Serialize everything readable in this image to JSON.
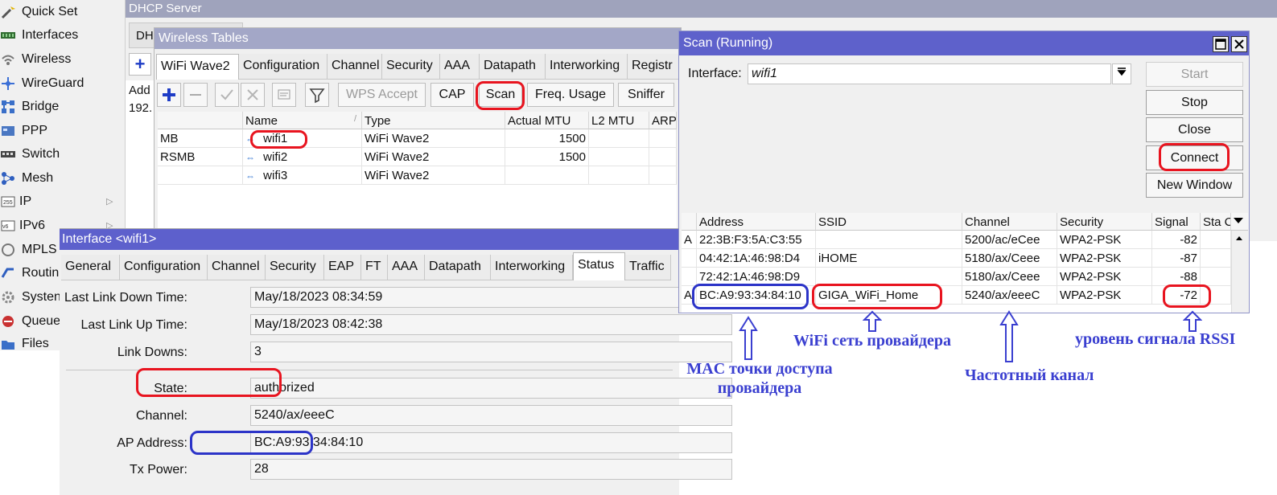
{
  "menu": {
    "items": [
      {
        "label": "Quick Set",
        "icon": "quick-set-icon",
        "arrow": ""
      },
      {
        "label": "Interfaces",
        "icon": "interfaces-icon",
        "arrow": ""
      },
      {
        "label": "Wireless",
        "icon": "wireless-icon",
        "arrow": ""
      },
      {
        "label": "WireGuard",
        "icon": "wireguard-icon",
        "arrow": ""
      },
      {
        "label": "Bridge",
        "icon": "bridge-icon",
        "arrow": ""
      },
      {
        "label": "PPP",
        "icon": "ppp-icon",
        "arrow": ""
      },
      {
        "label": "Switch",
        "icon": "switch-icon",
        "arrow": ""
      },
      {
        "label": "Mesh",
        "icon": "mesh-icon",
        "arrow": ""
      },
      {
        "label": "IP",
        "icon": "ip-icon",
        "arrow": "▷"
      },
      {
        "label": "IPv6",
        "icon": "ipv6-icon",
        "arrow": "▷"
      },
      {
        "label": "MPLS",
        "icon": "mpls-icon",
        "arrow": ""
      },
      {
        "label": "Routin",
        "icon": "routing-icon",
        "arrow": ""
      },
      {
        "label": "Systen",
        "icon": "system-icon",
        "arrow": ""
      },
      {
        "label": "Queue",
        "icon": "queue-icon",
        "arrow": ""
      },
      {
        "label": "Files",
        "icon": "files-icon",
        "arrow": ""
      }
    ]
  },
  "dhcp": {
    "title": "DHCP Server",
    "tab": "DH",
    "col_header": "Add",
    "cell": "192."
  },
  "wireless_tables": {
    "title": "Wireless Tables",
    "tabs": [
      "WiFi Wave2",
      "Configuration",
      "Channel",
      "Security",
      "AAA",
      "Datapath",
      "Interworking",
      "Registr"
    ],
    "buttons": {
      "wps_accept": "WPS Accept",
      "cap": "CAP",
      "scan": "Scan",
      "freq_usage": "Freq. Usage",
      "sniffer": "Sniffer"
    },
    "columns": [
      "",
      "Name",
      "Type",
      "Actual MTU",
      "L2 MTU",
      "ARP"
    ],
    "rows": [
      {
        "flags": "MB",
        "name": "wifi1",
        "type": "WiFi Wave2",
        "mtu": "1500"
      },
      {
        "flags": "RSMB",
        "name": "wifi2",
        "type": "WiFi Wave2",
        "mtu": "1500"
      },
      {
        "flags": "",
        "name": "wifi3",
        "type": "WiFi Wave2",
        "mtu": ""
      }
    ]
  },
  "interface_window": {
    "title": "Interface <wifi1>",
    "tabs": [
      "General",
      "Configuration",
      "Channel",
      "Security",
      "EAP",
      "FT",
      "AAA",
      "Datapath",
      "Interworking",
      "Status",
      "Traffic"
    ],
    "active_tab": "Status",
    "fields": [
      {
        "label": "Last Link Down Time:",
        "value": "May/18/2023 08:34:59"
      },
      {
        "label": "Last Link Up Time:",
        "value": "May/18/2023 08:42:38"
      },
      {
        "label": "Link Downs:",
        "value": "3"
      },
      {
        "label": "State:",
        "value": "authorized"
      },
      {
        "label": "Channel:",
        "value": "5240/ax/eeeC"
      },
      {
        "label": "AP Address:",
        "value": "BC:A9:93:34:84:10"
      },
      {
        "label": "Tx Power:",
        "value": "28"
      }
    ]
  },
  "scan_window": {
    "title": "Scan (Running)",
    "interface_label": "Interface:",
    "interface_value": "wifi1",
    "buttons": [
      "Start",
      "Stop",
      "Close",
      "Connect",
      "New Window"
    ],
    "columns": [
      "",
      "Address",
      "SSID",
      "Channel",
      "Security",
      "Signal",
      "Sta C"
    ],
    "rows": [
      {
        "flag": "A",
        "address": "22:3B:F3:5A:C3:55",
        "ssid": "",
        "channel": "5200/ac/eCee",
        "security": "WPA2-PSK",
        "signal": "-82"
      },
      {
        "flag": "",
        "address": "04:42:1A:46:98:D4",
        "ssid": "iHOME",
        "channel": "5180/ax/Ceee",
        "security": "WPA2-PSK",
        "signal": "-87"
      },
      {
        "flag": "",
        "address": "72:42:1A:46:98:D9",
        "ssid": "",
        "channel": "5180/ax/Ceee",
        "security": "WPA2-PSK",
        "signal": "-88"
      },
      {
        "flag": "A",
        "address": "BC:A9:93:34:84:10",
        "ssid": "GIGA_WiFi_Home",
        "channel": "5240/ax/eeeC",
        "security": "WPA2-PSK",
        "signal": "-72"
      }
    ]
  },
  "annotations": {
    "mac_line1": "MAC точки доступа",
    "mac_line2": "провайдера",
    "wifi_net": "WiFi сеть провайдера",
    "channel": "Частотный канал",
    "rssi": "уровень сигнала RSSI"
  },
  "colors": {
    "accent": "#5e61cb",
    "highlight_red": "#e8141f",
    "highlight_blue": "#2c34c8"
  }
}
